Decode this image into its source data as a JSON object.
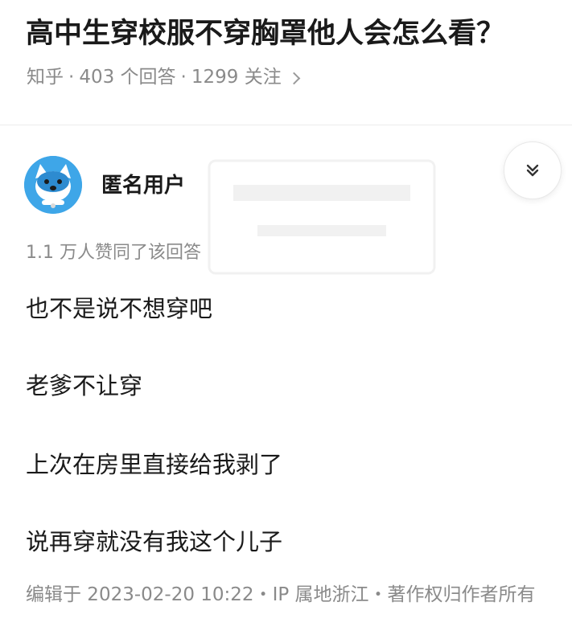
{
  "question": {
    "title": "高中生穿校服不穿胸罩他人会怎么看？",
    "source": "知乎",
    "answers_count": "403 个回答",
    "followers_count": "1299 关注"
  },
  "answer": {
    "author_name": "匿名用户",
    "votes_text": "1.1 万人赞同了该回答",
    "lines": [
      "也不是说不想穿吧",
      "老爹不让穿",
      "上次在房里直接给我剥了",
      "说再穿就没有我这个儿子"
    ],
    "edit_info": "编辑于 2023-02-20 10:22・IP 属地浙江・著作权归作者所有"
  },
  "icons": {
    "collapse": "chevrons-down-icon",
    "more": "chevron-right-icon",
    "avatar": "anonymous-avatar-icon"
  },
  "colors": {
    "text_primary": "#1a1a1a",
    "text_secondary": "#8a8a8a",
    "avatar_bg": "#3ea6e8"
  }
}
